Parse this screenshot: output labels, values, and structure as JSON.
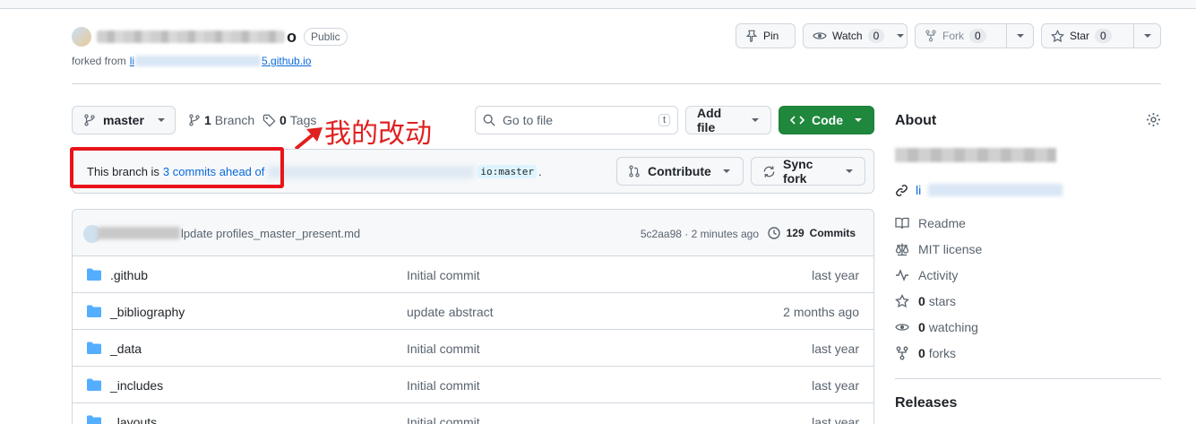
{
  "repo": {
    "name_tail": "o",
    "visibility": "Public",
    "forked_from_label": "forked from",
    "forked_from_tail": "5.github.io"
  },
  "header_actions": {
    "pin": "Pin",
    "watch": "Watch",
    "watch_count": "0",
    "fork": "Fork",
    "fork_count": "0",
    "star": "Star",
    "star_count": "0"
  },
  "toolbar": {
    "branch": "master",
    "branches_count": "1",
    "branches_label": "Branch",
    "tags_count": "0",
    "tags_label": "Tags",
    "search_placeholder": "Go to file",
    "search_shortcut": "t",
    "add_file": "Add file",
    "code": "Code"
  },
  "annotation": {
    "text": "我的改动",
    "color": "#e02020"
  },
  "ahead_bar": {
    "prefix": "This branch is",
    "link": "3 commits ahead of",
    "upstream_branch": "io:master",
    "suffix": ".",
    "contribute": "Contribute",
    "sync_fork": "Sync fork"
  },
  "latest_commit": {
    "message": "lpdate profiles_master_present.md",
    "hash": "5c2aa98",
    "time": "2 minutes ago",
    "separator": "·",
    "commits_count": "129",
    "commits_label": "Commits"
  },
  "files": [
    {
      "name": ".github",
      "message": "Initial commit",
      "time": "last year"
    },
    {
      "name": "_bibliography",
      "message": "update abstract",
      "time": "2 months ago"
    },
    {
      "name": "_data",
      "message": "Initial commit",
      "time": "last year"
    },
    {
      "name": "_includes",
      "message": "Initial commit",
      "time": "last year"
    },
    {
      "name": "_layouts",
      "message": "Initial commit",
      "time": "last year"
    }
  ],
  "about": {
    "title": "About",
    "link_prefix": "li",
    "items": [
      {
        "icon": "book-icon",
        "label": "Readme",
        "count": ""
      },
      {
        "icon": "law-icon",
        "label": "MIT license",
        "count": ""
      },
      {
        "icon": "pulse-icon",
        "label": "Activity",
        "count": ""
      },
      {
        "icon": "star-icon",
        "label": "stars",
        "count": "0"
      },
      {
        "icon": "eye-icon",
        "label": "watching",
        "count": "0"
      },
      {
        "icon": "fork-icon",
        "label": "forks",
        "count": "0"
      }
    ],
    "releases": "Releases"
  },
  "colors": {
    "accent_link": "#0969da",
    "primary_button": "#1f883d",
    "highlight_box": "#e8141a"
  }
}
